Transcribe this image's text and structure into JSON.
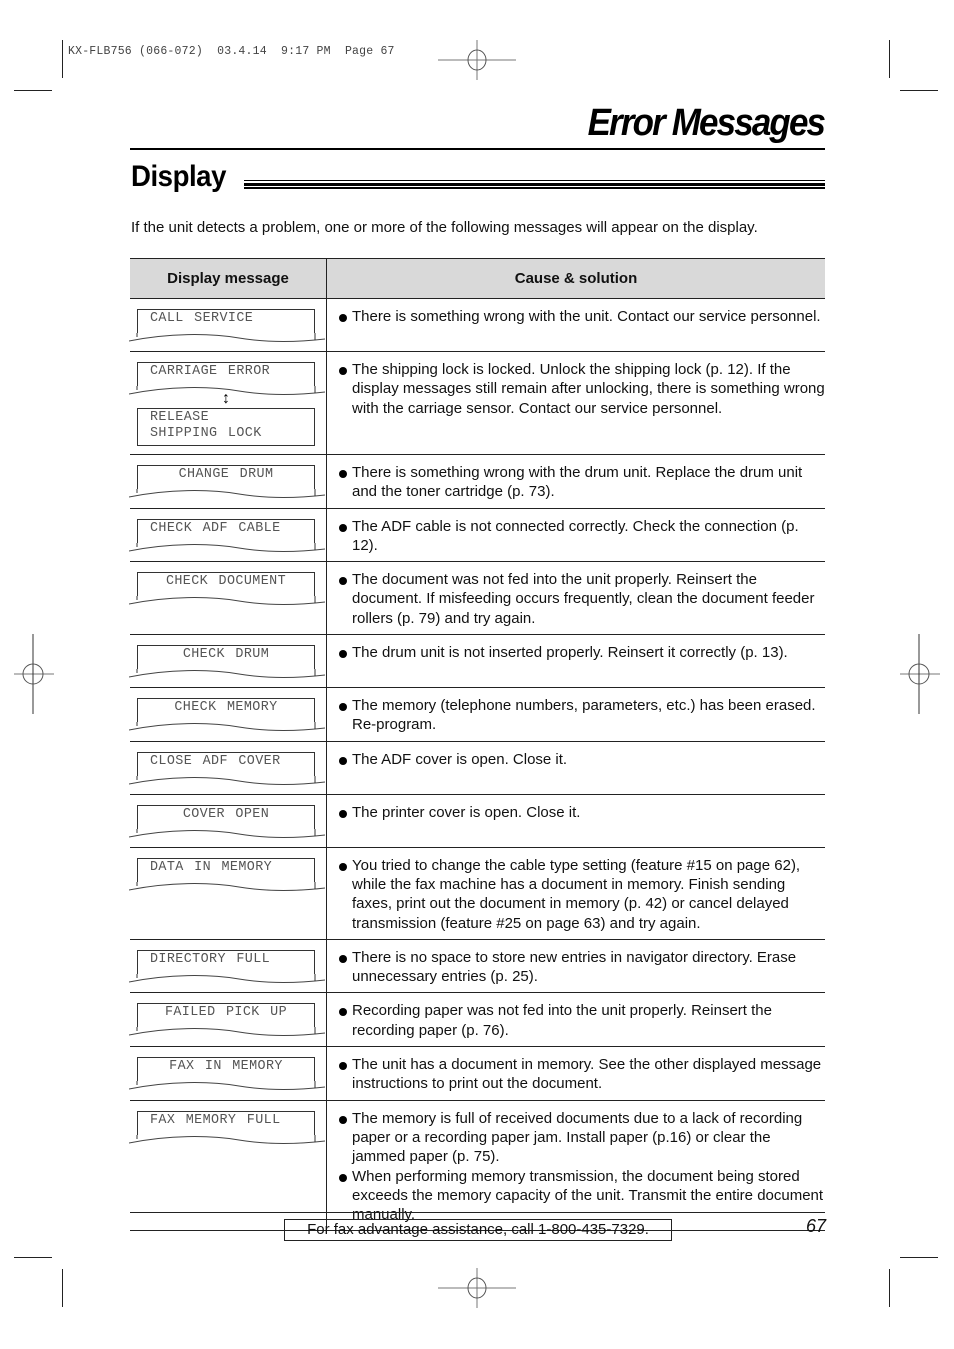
{
  "print_slug": "KX-FLB756 (066-072)  03.4.14  9:17 PM  Page 67",
  "header": {
    "chapter_title": "Error Messages",
    "section_title": "Display"
  },
  "intro_text": "If the unit detects a problem, one or more of the following messages will appear on the display.",
  "table": {
    "headers": [
      "Display message",
      "Cause & solution"
    ],
    "rows": [
      {
        "display": [
          "CALL SERVICE"
        ],
        "align": "left",
        "causes": [
          "There is something wrong with the unit. Contact our service personnel."
        ]
      },
      {
        "display": [
          "CARRIAGE ERROR"
        ],
        "alternate_display": [
          "RELEASE",
          "SHIPPING LOCK"
        ],
        "alternation_icon": "up-down-arrow-icon",
        "align": "left",
        "causes": [
          "The shipping lock is locked. Unlock the shipping lock (p. 12). If the display messages still remain after unlocking, there is something wrong with the carriage sensor. Contact our service personnel."
        ]
      },
      {
        "display": [
          "CHANGE DRUM"
        ],
        "align": "center",
        "causes": [
          "There is something wrong with the drum unit. Replace the drum unit and the toner cartridge (p. 73)."
        ]
      },
      {
        "display": [
          "CHECK ADF CABLE"
        ],
        "align": "left",
        "causes": [
          "The ADF cable is not connected correctly. Check the connection (p. 12)."
        ]
      },
      {
        "display": [
          "CHECK DOCUMENT"
        ],
        "align": "center",
        "causes": [
          "The document was not fed into the unit properly. Reinsert the document. If misfeeding occurs frequently, clean the document feeder rollers (p. 79) and try again."
        ]
      },
      {
        "display": [
          "CHECK DRUM"
        ],
        "align": "center",
        "causes": [
          "The drum unit is not inserted properly. Reinsert it correctly (p. 13)."
        ]
      },
      {
        "display": [
          "CHECK MEMORY"
        ],
        "align": "center",
        "causes": [
          "The memory (telephone numbers, parameters, etc.) has been erased. Re-program."
        ]
      },
      {
        "display": [
          "CLOSE ADF COVER"
        ],
        "align": "left",
        "causes": [
          "The ADF cover is open. Close it."
        ]
      },
      {
        "display": [
          "COVER OPEN"
        ],
        "align": "center",
        "causes": [
          "The printer cover is open. Close it."
        ]
      },
      {
        "display": [
          "DATA IN MEMORY"
        ],
        "align": "left",
        "causes": [
          "You tried to change the cable type setting (feature #15 on page 62), while the fax machine has a document in memory. Finish sending faxes, print out the document in memory (p. 42) or cancel delayed transmission (feature #25 on page 63) and try again."
        ]
      },
      {
        "display": [
          "DIRECTORY FULL"
        ],
        "align": "left",
        "causes": [
          "There is no space to store new entries in navigator directory. Erase unnecessary entries (p. 25)."
        ]
      },
      {
        "display": [
          "FAILED PICK UP"
        ],
        "align": "center",
        "causes": [
          "Recording paper was not fed into the unit properly. Reinsert the recording paper (p. 76)."
        ]
      },
      {
        "display": [
          "FAX IN MEMORY"
        ],
        "align": "center",
        "causes": [
          "The unit has a document in memory. See the other displayed message instructions to print out the document."
        ]
      },
      {
        "display": [
          "FAX MEMORY FULL"
        ],
        "align": "left",
        "causes": [
          "The memory is full of received documents due to a lack of recording paper or a recording paper jam. Install paper (p.16) or clear the jammed paper (p. 75).",
          "When performing memory transmission, the document being stored exceeds the memory capacity of the unit. Transmit the entire document manually."
        ]
      }
    ]
  },
  "footer": {
    "help_text": "For fax advantage assistance, call 1-800-435-7329.",
    "page_number": "67"
  }
}
